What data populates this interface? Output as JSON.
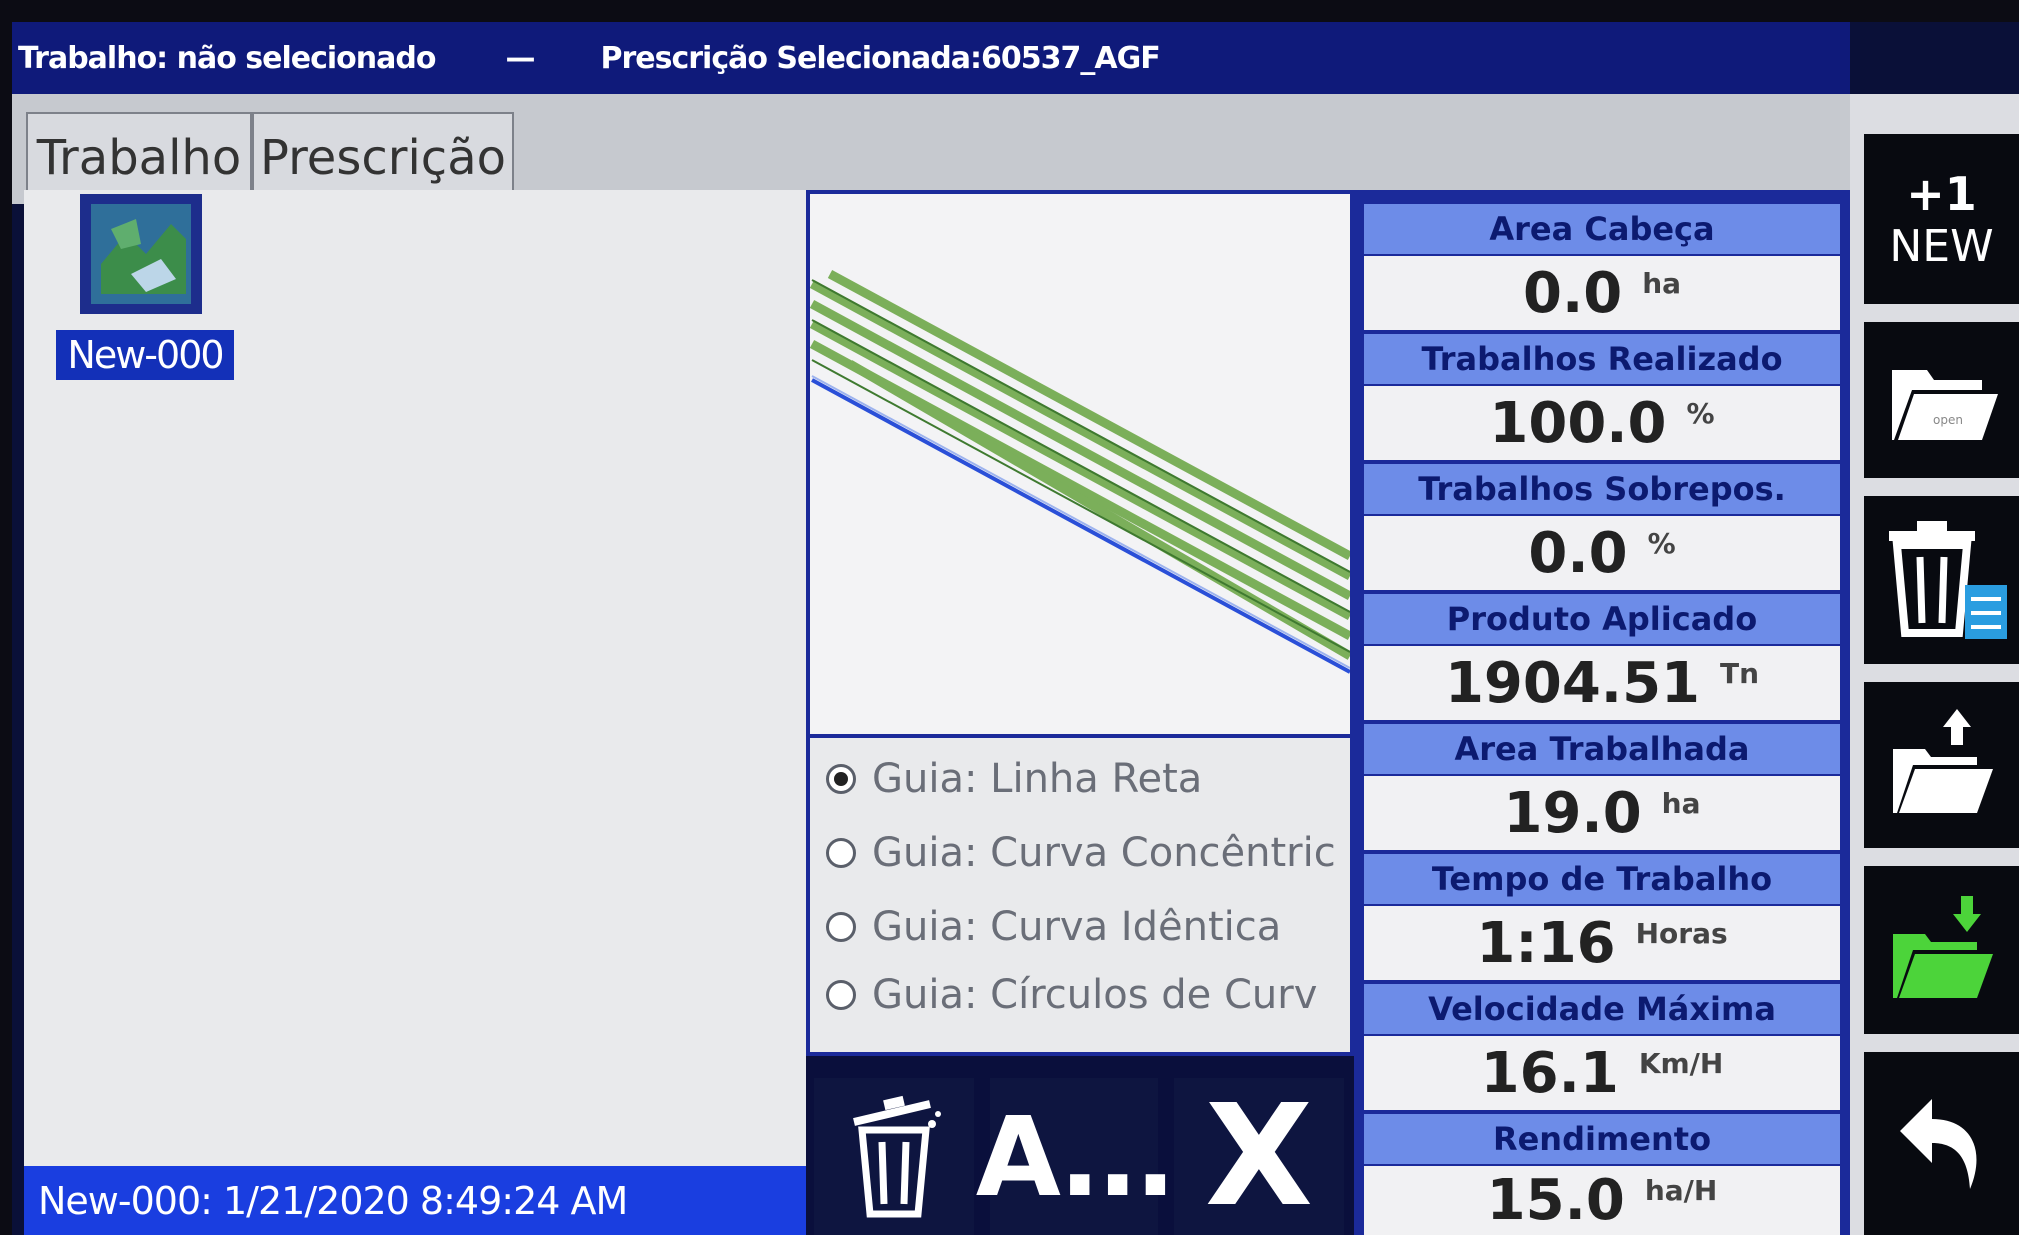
{
  "titlebar": {
    "job": "Trabalho: não selecionado",
    "separator": "—",
    "prescription": "Prescrição Selecionada:60537_AGF"
  },
  "tabs": [
    {
      "label": "Trabalho",
      "active": true
    },
    {
      "label": "Prescrição",
      "active": false
    }
  ],
  "job_list": {
    "items": [
      {
        "label": "New-000",
        "selected": true
      }
    ]
  },
  "status_bar": {
    "text": "New-000: 1/21/2020 8:49:24 AM"
  },
  "guidance": {
    "options": [
      {
        "label": "Guia: Linha Reta",
        "selected": true
      },
      {
        "label": "Guia: Curva Concêntric",
        "selected": false
      },
      {
        "label": "Guia: Curva Idêntica",
        "selected": false
      },
      {
        "label": "Guia: Círculos de Curv",
        "selected": false
      }
    ]
  },
  "actions": {
    "delete_icon": "trash-icon",
    "rename_label": "A...",
    "close_label": "X"
  },
  "stats": [
    {
      "label": "Area Cabeça",
      "value": "0.0",
      "unit": "ha"
    },
    {
      "label": "Trabalhos Realizado",
      "value": "100.0",
      "unit": "%"
    },
    {
      "label": "Trabalhos Sobrepos.",
      "value": "0.0",
      "unit": "%"
    },
    {
      "label": "Produto Aplicado",
      "value": "1904.51",
      "unit": "Tn"
    },
    {
      "label": "Area Trabalhada",
      "value": "19.0",
      "unit": "ha"
    },
    {
      "label": "Tempo de Trabalho",
      "value": "1:16",
      "unit": "Horas"
    },
    {
      "label": "Velocidade Máxima",
      "value": "16.1",
      "unit": "Km/H"
    },
    {
      "label": "Rendimento",
      "value": "15.0",
      "unit": "ha/H"
    }
  ],
  "sidebar": {
    "new_badge": "+1",
    "new_label": "NEW",
    "open_label": "open",
    "icons": [
      "new-job-icon",
      "open-folder-icon",
      "delete-file-icon",
      "export-folder-icon",
      "import-folder-icon",
      "back-arrow-icon"
    ]
  },
  "colors": {
    "titlebar_bg": "#0f1a7a",
    "stat_header_bg": "#6d8ce8",
    "status_bar_bg": "#1a3ee0",
    "coverage_green": "#6fa84a",
    "boundary_blue": "#2a4fd8",
    "import_green": "#4cd43a"
  }
}
